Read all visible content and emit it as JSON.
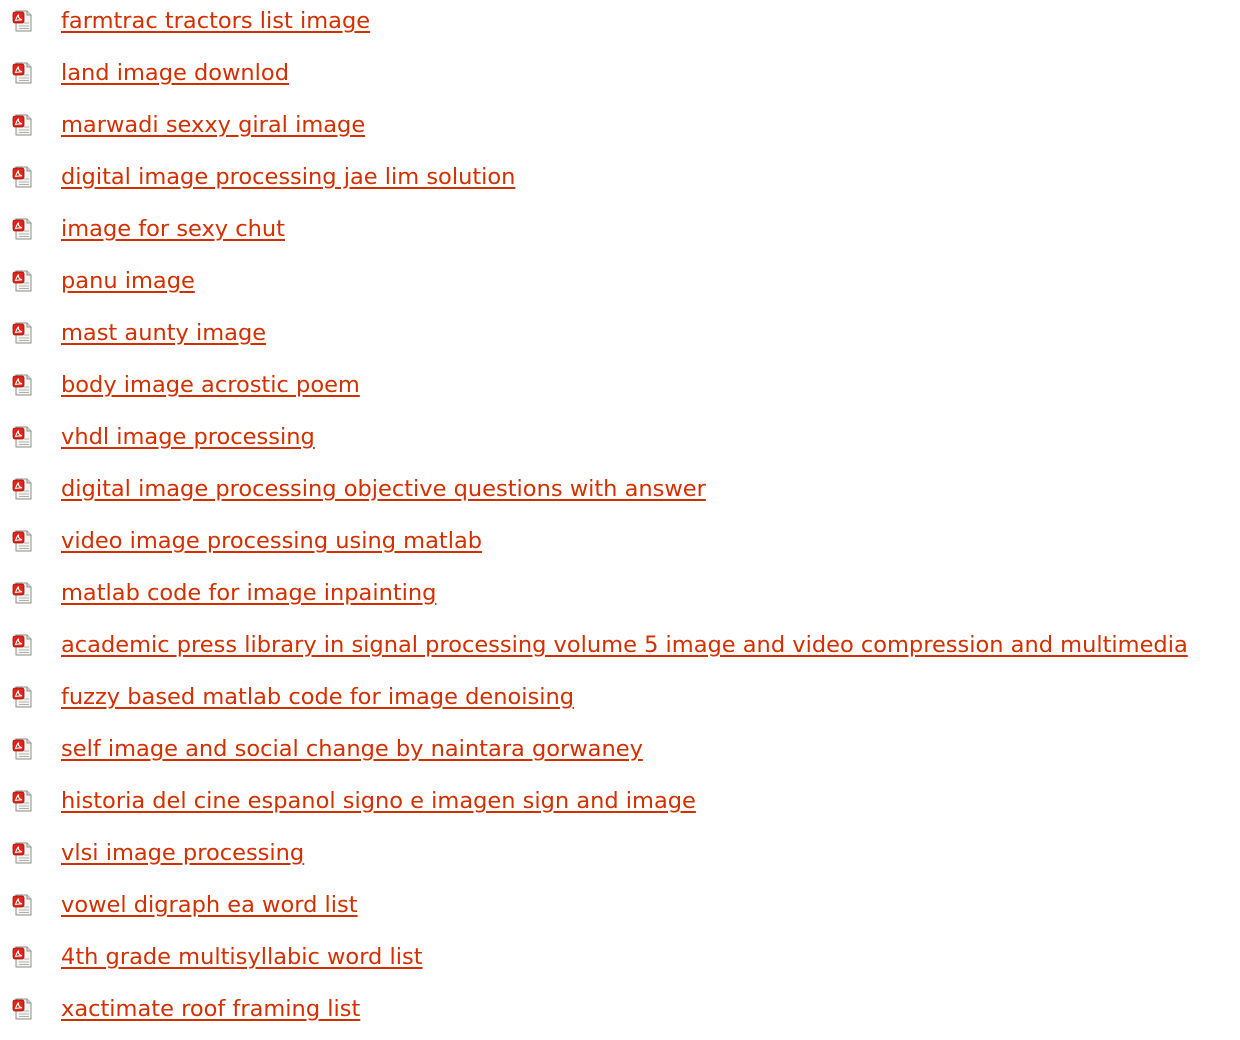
{
  "icon": "pdf-file-icon",
  "colors": {
    "link": "#d33000",
    "icon_red": "#e02419",
    "icon_page": "#f4f4f2"
  },
  "links": [
    {
      "label": "farmtrac tractors list image"
    },
    {
      "label": "land image downlod"
    },
    {
      "label": "marwadi sexxy giral image"
    },
    {
      "label": "digital image processing jae lim solution"
    },
    {
      "label": "image for sexy chut"
    },
    {
      "label": "panu image"
    },
    {
      "label": "mast aunty image"
    },
    {
      "label": "body image acrostic poem"
    },
    {
      "label": "vhdl image processing"
    },
    {
      "label": "digital image processing objective questions with answer"
    },
    {
      "label": "video image processing using matlab"
    },
    {
      "label": "matlab code for image inpainting"
    },
    {
      "label": "academic press library in signal processing volume 5 image and video compression and multimedia"
    },
    {
      "label": "fuzzy based matlab code for image denoising"
    },
    {
      "label": "self image and social change by naintara gorwaney"
    },
    {
      "label": "historia del cine espanol signo e imagen sign and image"
    },
    {
      "label": "vlsi image processing"
    },
    {
      "label": "vowel digraph ea word list"
    },
    {
      "label": "4th grade multisyllabic word list"
    },
    {
      "label": "xactimate roof framing list"
    }
  ]
}
